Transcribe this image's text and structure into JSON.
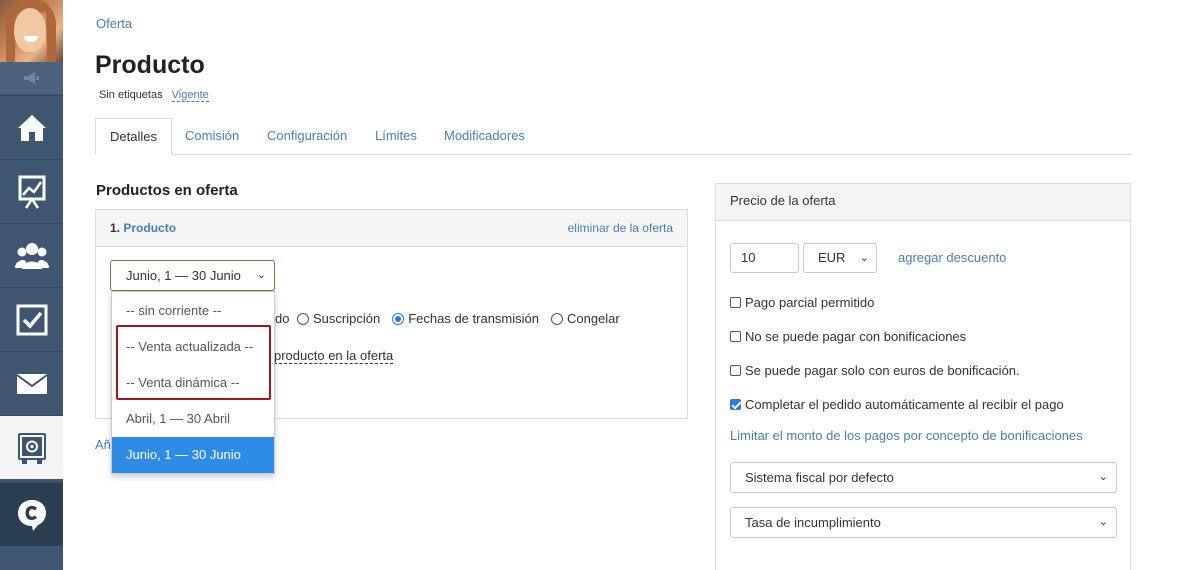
{
  "breadcrumb": "Oferta",
  "page_title": "Producto",
  "tags": {
    "no_tags": "Sin etiquetas",
    "status": "Vigente"
  },
  "tabs": [
    {
      "label": "Detalles",
      "active": true
    },
    {
      "label": "Comisión"
    },
    {
      "label": "Configuración"
    },
    {
      "label": "Límites"
    },
    {
      "label": "Modificadores"
    }
  ],
  "products_section": {
    "title": "Productos en oferta",
    "item_number": "1.",
    "item_name": "Producto",
    "remove_label": "eliminar de la oferta",
    "period_selected": "Junio, 1 — 30 Junio",
    "type_partial": "do",
    "type_options": [
      {
        "label": "Suscripción",
        "selected": false
      },
      {
        "label": "Fechas de transmisión",
        "selected": true
      },
      {
        "label": "Congelar",
        "selected": false
      }
    ],
    "add_product_label": "producto en la oferta",
    "add_more_partial": "Añ"
  },
  "period_dropdown": {
    "options": [
      "-- sin corriente --",
      "-- Venta actualizada --",
      "-- Venta dinámica --",
      "Abril, 1 — 30 Abril",
      "Junio, 1 — 30 Junio"
    ],
    "selected_index": 4,
    "highlight_color": "#a4141c"
  },
  "price_panel": {
    "title": "Precio de la oferta",
    "price_value": "10",
    "currency": "EUR",
    "add_discount": "agregar descuento",
    "checkboxes": [
      {
        "label": "Pago parcial permitido",
        "checked": false
      },
      {
        "label": "No se puede pagar con bonificaciones",
        "checked": false
      },
      {
        "label": "Se puede pagar solo con euros de bonificación.",
        "checked": false
      },
      {
        "label": "Completar el pedido automáticamente al recibir el pago",
        "checked": true
      }
    ],
    "limit_link": "Limitar el monto de los pagos por concepto de bonificaciones",
    "tax_system": "Sistema fiscal por defecto",
    "default_rate": "Tasa de incumplimiento"
  },
  "sidebar": {
    "items": [
      {
        "icon": "home-icon"
      },
      {
        "icon": "chart-icon"
      },
      {
        "icon": "users-icon"
      },
      {
        "icon": "tasks-icon"
      },
      {
        "icon": "mail-icon"
      },
      {
        "icon": "safe-icon",
        "active": true
      },
      {
        "icon": "chat-icon"
      }
    ]
  },
  "colors": {
    "sidebar": "#3e5670",
    "link": "#4a7eb3",
    "accent": "#2f8ce6"
  }
}
